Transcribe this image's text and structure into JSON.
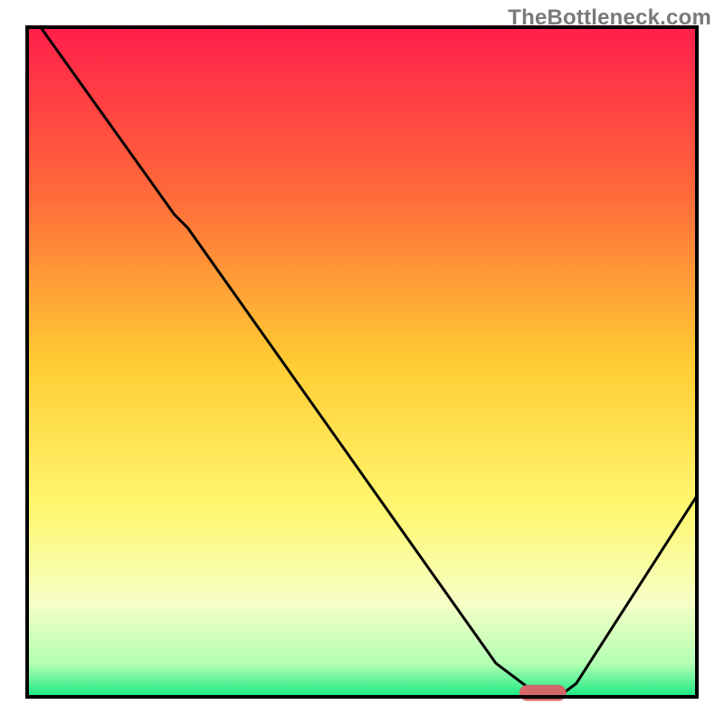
{
  "watermark": "TheBottleneck.com",
  "chart_data": {
    "type": "line",
    "title": "",
    "xlabel": "",
    "ylabel": "",
    "xlim": [
      0,
      100
    ],
    "ylim": [
      0,
      100
    ],
    "grid": false,
    "legend": false,
    "background_gradient_stops": [
      {
        "offset": 0.0,
        "color": "#ff1f4b"
      },
      {
        "offset": 0.25,
        "color": "#ff6a3a"
      },
      {
        "offset": 0.5,
        "color": "#ffcc33"
      },
      {
        "offset": 0.72,
        "color": "#fff870"
      },
      {
        "offset": 0.86,
        "color": "#f6ffc6"
      },
      {
        "offset": 0.95,
        "color": "#b4ffb4"
      },
      {
        "offset": 1.0,
        "color": "#17e981"
      }
    ],
    "series": [
      {
        "name": "bottleneck-curve",
        "stroke": "#000000",
        "x": [
          2,
          12,
          22,
          24,
          70,
          76,
          80,
          82,
          100
        ],
        "y": [
          100,
          86,
          72,
          70,
          5,
          0.5,
          0.5,
          2,
          30
        ]
      }
    ],
    "marker": {
      "name": "sweet-spot-marker",
      "x": 77,
      "y": 0.6,
      "color": "#d4676a",
      "width": 7,
      "height": 2.4
    },
    "frame_color": "#000000"
  }
}
